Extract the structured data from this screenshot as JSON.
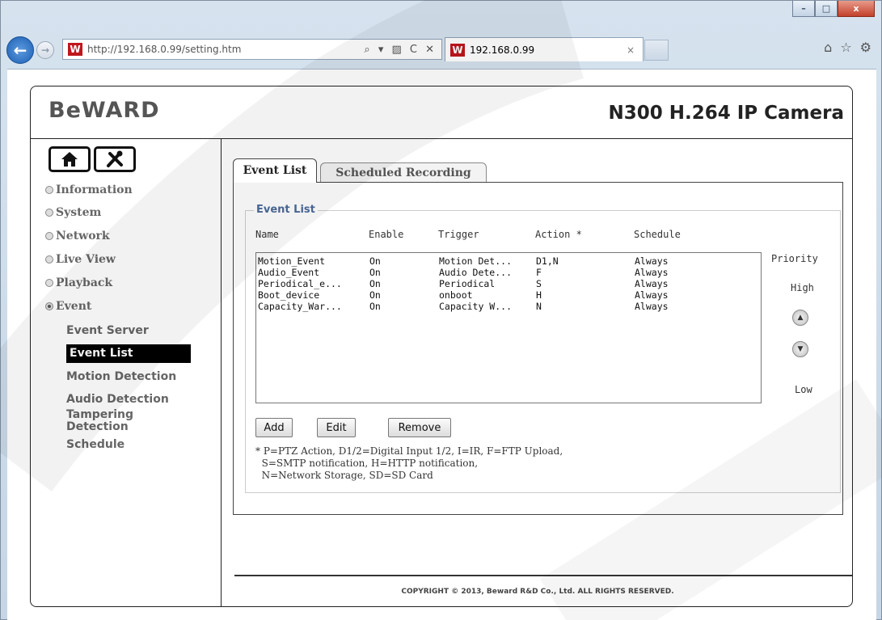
{
  "browser": {
    "url": "http://192.168.0.99/setting.htm",
    "url_tools": "⌕ ▾ ▨ C ✕",
    "tab_title": "192.168.0.99",
    "tab_close": "×",
    "win_min": "–",
    "win_max": "□",
    "win_close": "x",
    "back_glyph": "←",
    "fwd_glyph": "→"
  },
  "header": {
    "logo": "BeWARD",
    "product_title": "N300 H.264 IP Camera"
  },
  "sidebar": {
    "menu": [
      "Information",
      "System",
      "Network",
      "Live View",
      "Playback",
      "Event"
    ],
    "submenu": [
      "Event Server",
      "Event List",
      "Motion Detection",
      "Audio Detection",
      "Tampering Detection",
      "Schedule"
    ]
  },
  "tabs": {
    "event_list": "Event List",
    "scheduled_recording": "Scheduled Recording"
  },
  "event_list": {
    "legend": "Event List",
    "columns": [
      "Name",
      "Enable",
      "Trigger",
      "Action *",
      "Schedule"
    ],
    "rows": [
      [
        "Motion_Event",
        "On",
        "Motion Det...",
        "D1,N",
        "Always"
      ],
      [
        "Audio_Event",
        "On",
        "Audio Dete...",
        "F",
        "Always"
      ],
      [
        "Periodical_e...",
        "On",
        "Periodical",
        "S",
        "Always"
      ],
      [
        "Boot_device",
        "On",
        "onboot",
        "H",
        "Always"
      ],
      [
        "Capacity_War...",
        "On",
        "Capacity W...",
        "N",
        "Always"
      ]
    ],
    "priority_label": "Priority",
    "high_label": "High",
    "low_label": "Low",
    "add_label": "Add",
    "edit_label": "Edit",
    "remove_label": "Remove",
    "note_line1": "* P=PTZ Action, D1/2=Digital Input 1/2, I=IR, F=FTP Upload,",
    "note_line2": "  S=SMTP notification, H=HTTP notification,",
    "note_line3": "  N=Network Storage, SD=SD Card"
  },
  "footer": {
    "copyright": "COPYRIGHT © 2013, Beward R&D Co., Ltd. ALL RIGHTS RESERVED."
  },
  "colors": {
    "legend_blue": "#4a6a9a",
    "active_menu_bg": "#000000",
    "brand_red": "#c0161c"
  },
  "icons": {
    "home": "home-icon",
    "tools": "tools-icon",
    "priority_up": "arrow-up-icon",
    "priority_down": "arrow-down-icon"
  }
}
